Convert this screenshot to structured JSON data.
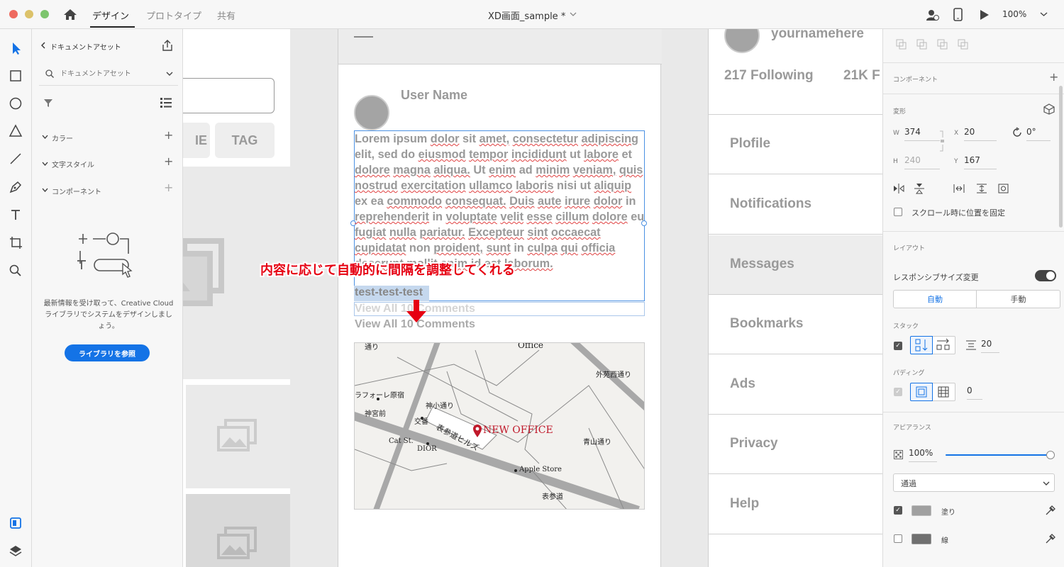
{
  "titlebar": {
    "tabs": [
      "デザイン",
      "プロトタイプ",
      "共有"
    ],
    "document_title": "XD画面_sample *",
    "zoom": "100%"
  },
  "assets": {
    "back_label": "ドキュメントアセット",
    "search_placeholder": "ドキュメントアセット",
    "sections": [
      "カラー",
      "文字スタイル",
      "コンポーネント"
    ],
    "empty_message": "最新情報を受け取って、Creative Cloud ライブラリでシステムをデザインしましょう。",
    "library_button": "ライブラリを参照"
  },
  "left_artboard": {
    "tags": [
      "IE",
      "TAG"
    ]
  },
  "phone": {
    "user_name": "User Name",
    "body_text": "Lorem ipsum dolor sit amet, consectetur adipiscing elit, sed do eiusmod tempor incididunt ut labore et dolore magna aliqua. Ut enim ad minim veniam, quis nostrud exercitation ullamco laboris nisi ut aliquip ex ea commodo consequat. Duis aute irure dolor in reprehenderit in voluptate velit esse cillum dolore eu fugiat nulla pariatur. Excepteur sint occaecat cupidatat non proident, sunt in culpa qui officia deserunt mollit anim id est laborum.",
    "selected_text": "test-test-test",
    "comments_ghost": "View All 10 Comments",
    "comments": "View All 10 Comments",
    "annotation": "内容に応じて自動的に間隔を調整してくれる",
    "map": {
      "office_label": "NEW OFFICE",
      "labels": [
        "Office",
        "外苑西通り",
        "ラフォーレ原宿",
        "神小通り",
        "神宮前",
        "交番",
        "表参道ヒルズ",
        "Cat St.",
        "DIOR",
        "青山通り",
        "Apple Store",
        "表参道",
        "通り"
      ]
    }
  },
  "right_artboard": {
    "username": "yournamehere",
    "following": "217 Following",
    "followers": "21K F",
    "menu": [
      "Plofile",
      "Notifications",
      "Messages",
      "Bookmarks",
      "Ads",
      "Privacy",
      "Help"
    ]
  },
  "properties": {
    "component_label": "コンポーネント",
    "transform_label": "変形",
    "w": "374",
    "x": "20",
    "rotation": "0°",
    "h": "240",
    "y": "167",
    "fix_scroll_label": "スクロール時に位置を固定",
    "layout_label": "レイアウト",
    "responsive_label": "レスポンシブサイズ変更",
    "responsive_on": true,
    "mode_auto": "自動",
    "mode_manual": "手動",
    "stack_label": "スタック",
    "stack_spacing": "20",
    "padding_label": "パディング",
    "padding_value": "0",
    "appearance_label": "アピアランス",
    "opacity": "100%",
    "opacity_fraction": 1.0,
    "blend_mode": "通過",
    "fill_label": "塗り",
    "stroke_label": "線",
    "fill_color": "#a0a0a0",
    "stroke_color": "#707070"
  }
}
